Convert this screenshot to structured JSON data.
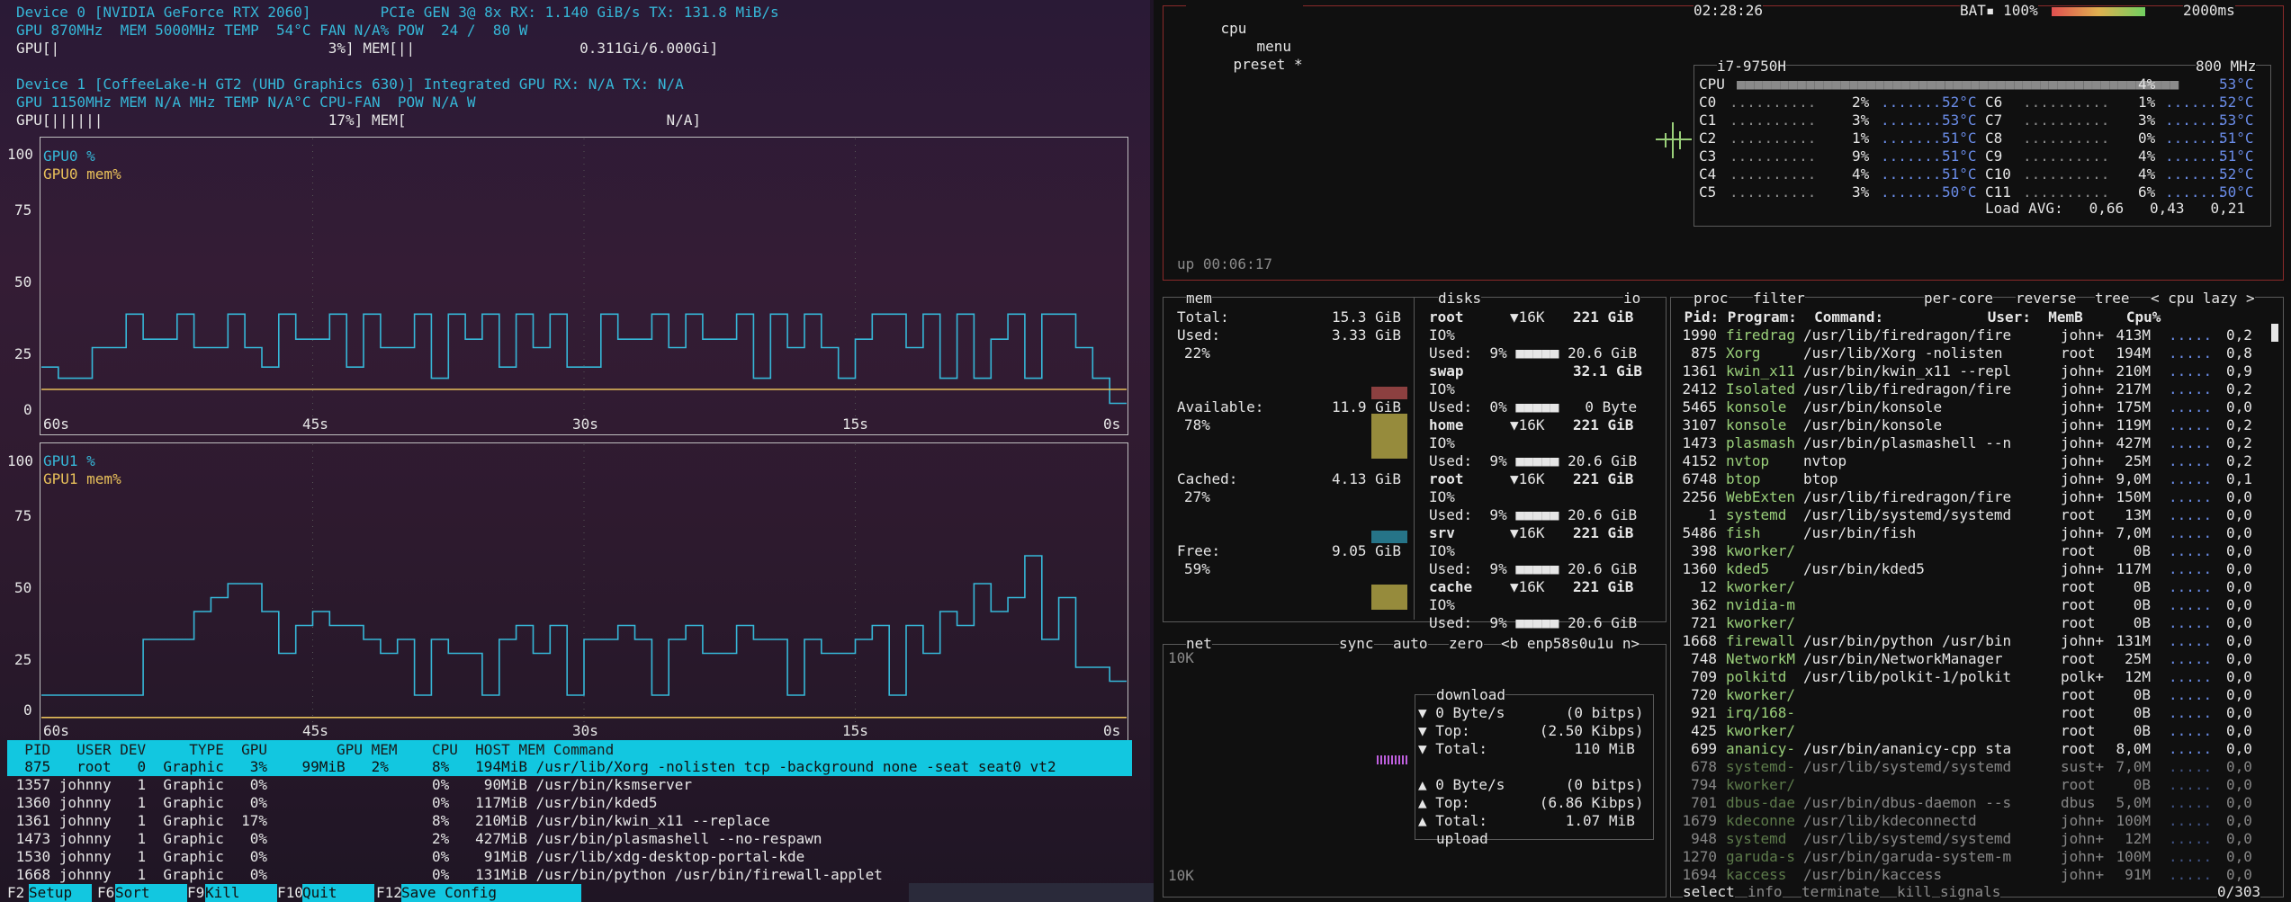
{
  "nvtop": {
    "dev0_line1": "Device 0 [NVIDIA GeForce RTX 2060]        PCIe GEN 3@ 8x RX: 1.140 GiB/s TX: 131.8 MiB/s",
    "dev0_line2": "GPU 870MHz  MEM 5000MHz TEMP  54°C FAN N/A% POW  24 /  80 W",
    "dev0_line3": "GPU[|                               3%] MEM[||                   0.311Gi/6.000Gi]",
    "dev1_line1": "Device 1 [CoffeeLake-H GT2 (UHD Graphics 630)] Integrated GPU RX: N/A TX: N/A",
    "dev1_line2": "GPU 1150MHz MEM N/A MHz TEMP N/A°C CPU-FAN  POW N/A W",
    "dev1_line3": "GPU[||||||                          17%] MEM[                              N/A]",
    "chart1_legend1": "GPU0 %",
    "chart1_legend2": "GPU0 mem%",
    "chart2_legend1": "GPU1 %",
    "chart2_legend2": "GPU1 mem%",
    "y_ticks": [
      "100",
      "75",
      "50",
      "25",
      "0"
    ],
    "x_ticks": [
      "60s",
      "45s",
      "30s",
      "15s",
      "0s"
    ],
    "proc_header": "  PID   USER DEV     TYPE  GPU        GPU MEM    CPU  HOST MEM Command",
    "proc_rows": [
      "  875   root   0  Graphic   3%    99MiB   2%     8%   194MiB /usr/lib/Xorg -nolisten tcp -background none -seat seat0 vt2",
      " 1357 johnny   1  Graphic   0%                   0%    90MiB /usr/bin/ksmserver",
      " 1360 johnny   1  Graphic   0%                   0%   117MiB /usr/bin/kded5",
      " 1361 johnny   1  Graphic  17%                   8%   210MiB /usr/bin/kwin_x11 --replace",
      " 1473 johnny   1  Graphic   0%                   2%   427MiB /usr/bin/plasmashell --no-respawn",
      " 1530 johnny   1  Graphic   0%                   0%    91MiB /usr/lib/xdg-desktop-portal-kde",
      " 1668 johnny   1  Graphic   0%                   0%   131MiB /usr/bin/python /usr/bin/firewall-applet"
    ],
    "fkeys": [
      {
        "k": "F2",
        "l": "Setup"
      },
      {
        "k": "F6",
        "l": "Sort"
      },
      {
        "k": "F9",
        "l": "Kill"
      },
      {
        "k": "F10",
        "l": "Quit"
      },
      {
        "k": "F12",
        "l": "Save Config"
      }
    ]
  },
  "chart_data": [
    {
      "type": "line",
      "series": [
        {
          "name": "GPU0 %",
          "values": [
            18,
            14,
            14,
            25,
            25,
            37,
            28,
            28,
            37,
            25,
            25,
            37,
            25,
            18,
            37,
            28,
            28,
            37,
            18,
            37,
            25,
            25,
            37,
            14,
            37,
            28,
            37,
            18,
            37,
            25,
            37,
            18,
            18,
            37,
            28,
            28,
            37,
            25,
            37,
            28,
            28,
            37,
            14,
            37,
            25,
            37,
            25,
            14,
            28,
            37,
            37,
            25,
            37,
            14,
            37,
            14,
            28,
            37,
            14,
            37,
            37,
            25,
            14,
            5
          ]
        },
        {
          "name": "GPU0 mem%",
          "values": [
            10,
            10,
            10,
            10,
            10,
            10,
            10,
            10,
            10,
            10,
            10,
            10,
            10,
            10,
            10,
            10,
            10,
            10,
            10,
            10,
            10,
            10,
            10,
            10,
            10,
            10,
            10,
            10,
            10,
            10,
            10,
            10,
            10,
            10,
            10,
            10,
            10,
            10,
            10,
            10,
            10,
            10,
            10,
            10,
            10,
            10,
            10,
            10,
            10,
            10,
            10,
            10,
            10,
            10,
            10,
            10,
            10,
            10,
            10,
            10,
            10,
            10,
            10,
            10
          ]
        }
      ],
      "ylim": [
        0,
        100
      ]
    },
    {
      "type": "line",
      "series": [
        {
          "name": "GPU1 %",
          "values": [
            10,
            10,
            10,
            10,
            10,
            10,
            30,
            30,
            30,
            40,
            45,
            50,
            50,
            40,
            25,
            35,
            40,
            35,
            35,
            30,
            25,
            30,
            10,
            30,
            25,
            25,
            10,
            30,
            35,
            25,
            35,
            10,
            30,
            30,
            35,
            30,
            10,
            30,
            35,
            25,
            25,
            35,
            30,
            30,
            10,
            30,
            25,
            25,
            30,
            35,
            10,
            35,
            25,
            40,
            35,
            50,
            40,
            45,
            60,
            30,
            45,
            20,
            20,
            15
          ]
        },
        {
          "name": "GPU1 mem%",
          "values": [
            2,
            2,
            2,
            2,
            2,
            2,
            2,
            2,
            2,
            2,
            2,
            2,
            2,
            2,
            2,
            2,
            2,
            2,
            2,
            2,
            2,
            2,
            2,
            2,
            2,
            2,
            2,
            2,
            2,
            2,
            2,
            2,
            2,
            2,
            2,
            2,
            2,
            2,
            2,
            2,
            2,
            2,
            2,
            2,
            2,
            2,
            2,
            2,
            2,
            2,
            2,
            2,
            2,
            2,
            2,
            2,
            2,
            2,
            2,
            2,
            2,
            2,
            2,
            2
          ]
        }
      ],
      "ylim": [
        0,
        100
      ]
    }
  ],
  "btop": {
    "cpu_tabs": {
      "cpu": "cpu",
      "menu": "menu",
      "preset": "preset *"
    },
    "clock": "02:28:26",
    "bat": "BAT▪ 100%",
    "interval": "2000ms",
    "cpu_model": "i7-9750H",
    "cpu_freq": "800 MHz",
    "cpu_total": {
      "label": "CPU",
      "pct": "4%",
      "temp": "53°C"
    },
    "cores": [
      {
        "l": "C0",
        "p": "2%",
        "t": "52°C",
        "l2": "C6",
        "p2": "1%",
        "t2": "52°C"
      },
      {
        "l": "C1",
        "p": "3%",
        "t": "53°C",
        "l2": "C7",
        "p2": "3%",
        "t2": "53°C"
      },
      {
        "l": "C2",
        "p": "1%",
        "t": "51°C",
        "l2": "C8",
        "p2": "0%",
        "t2": "51°C"
      },
      {
        "l": "C3",
        "p": "9%",
        "t": "51°C",
        "l2": "C9",
        "p2": "4%",
        "t2": "51°C"
      },
      {
        "l": "C4",
        "p": "4%",
        "t": "51°C",
        "l2": "C10",
        "p2": "4%",
        "t2": "52°C"
      },
      {
        "l": "C5",
        "p": "3%",
        "t": "50°C",
        "l2": "C11",
        "p2": "6%",
        "t2": "50°C"
      }
    ],
    "load_avg": "Load AVG:   0,66   0,43   0,21",
    "uptime": "up 00:06:17",
    "mem": {
      "title": "mem",
      "disks_title": "disks",
      "io": "io",
      "total_label": "Total:",
      "total": "15.3 GiB",
      "used_label": "Used:",
      "used": "3.33 GiB",
      "used_pct": "22%",
      "avail_label": "Available:",
      "avail": "11.9 GiB",
      "avail_pct": "78%",
      "cached_label": "Cached:",
      "cached": "4.13 GiB",
      "cached_pct": "27%",
      "free_label": "Free:",
      "free": "9.05 GiB",
      "free_pct": "59%"
    },
    "disks": [
      {
        "name": "root",
        "io": "▼16K",
        "size": "221 GiB",
        "used": "Used:  9% ■■■■■ 20.6 GiB"
      },
      {
        "name": "swap",
        "io": "",
        "size": "32.1 GiB",
        "used": "Used:  0% ■■■■■   0 Byte"
      },
      {
        "name": "home",
        "io": "▼16K",
        "size": "221 GiB",
        "used": "Used:  9% ■■■■■ 20.6 GiB"
      },
      {
        "name": "root",
        "io": "▼16K",
        "size": "221 GiB",
        "used": "Used:  9% ■■■■■ 20.6 GiB"
      },
      {
        "name": "srv",
        "io": "▼16K",
        "size": "221 GiB",
        "used": "Used:  9% ■■■■■ 20.6 GiB"
      },
      {
        "name": "cache",
        "io": "▼16K",
        "size": "221 GiB",
        "used": "Used:  9% ■■■■■ 20.6 GiB"
      }
    ],
    "io_label": "IO%",
    "net": {
      "title": "net",
      "sync": "sync",
      "auto": "auto",
      "zero": "zero",
      "iface": "<b enp58s0u1u n>",
      "scale_top": "10K",
      "scale_bot": "10K",
      "download": "download",
      "dl_rows": [
        "▼ 0 Byte/s       (0 bitps)",
        "▼ Top:        (2.50 Kibps)",
        "▼ Total:          110 MiB"
      ],
      "ul_rows": [
        "▲ 0 Byte/s       (0 bitps)",
        "▲ Top:        (6.86 Kibps)",
        "▲ Total:         1.07 MiB"
      ],
      "upload": "upload"
    },
    "proc": {
      "title": "proc",
      "filter": "filter",
      "per_core": "per-core",
      "reverse": "reverse",
      "tree": "tree",
      "sort": "< cpu lazy >",
      "header": " Pid: Program:  Command:            User:  MemB     Cpu%",
      "rows": [
        {
          "pid": "1990",
          "prog": "firedrag",
          "cmd": "/usr/lib/firedragon/fire",
          "user": "john+",
          "mem": "413M",
          "cpu": "0,2"
        },
        {
          "pid": "875",
          "prog": "Xorg",
          "cmd": "/usr/lib/Xorg -nolisten",
          "user": "root",
          "mem": "194M",
          "cpu": "0,8"
        },
        {
          "pid": "1361",
          "prog": "kwin_x11",
          "cmd": "/usr/bin/kwin_x11 --repl",
          "user": "john+",
          "mem": "210M",
          "cpu": "0,9"
        },
        {
          "pid": "2412",
          "prog": "Isolated",
          "cmd": "/usr/lib/firedragon/fire",
          "user": "john+",
          "mem": "217M",
          "cpu": "0,2"
        },
        {
          "pid": "5465",
          "prog": "konsole",
          "cmd": "/usr/bin/konsole",
          "user": "john+",
          "mem": "175M",
          "cpu": "0,0"
        },
        {
          "pid": "3107",
          "prog": "konsole",
          "cmd": "/usr/bin/konsole",
          "user": "john+",
          "mem": "119M",
          "cpu": "0,2"
        },
        {
          "pid": "1473",
          "prog": "plasmash",
          "cmd": "/usr/bin/plasmashell --n",
          "user": "john+",
          "mem": "427M",
          "cpu": "0,2"
        },
        {
          "pid": "4152",
          "prog": "nvtop",
          "cmd": "nvtop",
          "user": "john+",
          "mem": "25M",
          "cpu": "0,2"
        },
        {
          "pid": "6748",
          "prog": "btop",
          "cmd": "btop",
          "user": "john+",
          "mem": "9,0M",
          "cpu": "0,1"
        },
        {
          "pid": "2256",
          "prog": "WebExten",
          "cmd": "/usr/lib/firedragon/fire",
          "user": "john+",
          "mem": "150M",
          "cpu": "0,0"
        },
        {
          "pid": "1",
          "prog": "systemd",
          "cmd": "/usr/lib/systemd/systemd",
          "user": "root",
          "mem": "13M",
          "cpu": "0,0"
        },
        {
          "pid": "5486",
          "prog": "fish",
          "cmd": "/usr/bin/fish",
          "user": "john+",
          "mem": "7,0M",
          "cpu": "0,0"
        },
        {
          "pid": "398",
          "prog": "kworker/",
          "cmd": "",
          "user": "root",
          "mem": "0B",
          "cpu": "0,0"
        },
        {
          "pid": "1360",
          "prog": "kded5",
          "cmd": "/usr/bin/kded5",
          "user": "john+",
          "mem": "117M",
          "cpu": "0,0"
        },
        {
          "pid": "12",
          "prog": "kworker/",
          "cmd": "",
          "user": "root",
          "mem": "0B",
          "cpu": "0,0"
        },
        {
          "pid": "362",
          "prog": "nvidia-m",
          "cmd": "",
          "user": "root",
          "mem": "0B",
          "cpu": "0,0"
        },
        {
          "pid": "721",
          "prog": "kworker/",
          "cmd": "",
          "user": "root",
          "mem": "0B",
          "cpu": "0,0"
        },
        {
          "pid": "1668",
          "prog": "firewall",
          "cmd": "/usr/bin/python /usr/bin",
          "user": "john+",
          "mem": "131M",
          "cpu": "0,0"
        },
        {
          "pid": "748",
          "prog": "NetworkM",
          "cmd": "/usr/bin/NetworkManager",
          "user": "root",
          "mem": "25M",
          "cpu": "0,0"
        },
        {
          "pid": "709",
          "prog": "polkitd",
          "cmd": "/usr/lib/polkit-1/polkit",
          "user": "polk+",
          "mem": "12M",
          "cpu": "0,0"
        },
        {
          "pid": "720",
          "prog": "kworker/",
          "cmd": "",
          "user": "root",
          "mem": "0B",
          "cpu": "0,0"
        },
        {
          "pid": "921",
          "prog": "irq/168-",
          "cmd": "",
          "user": "root",
          "mem": "0B",
          "cpu": "0,0"
        },
        {
          "pid": "425",
          "prog": "kworker/",
          "cmd": "",
          "user": "root",
          "mem": "0B",
          "cpu": "0,0"
        },
        {
          "pid": "699",
          "prog": "ananicy-",
          "cmd": "/usr/bin/ananicy-cpp sta",
          "user": "root",
          "mem": "8,0M",
          "cpu": "0,0"
        },
        {
          "pid": "678",
          "prog": "systemd-",
          "cmd": "/usr/lib/systemd/systemd",
          "user": "sust+",
          "mem": "7,0M",
          "cpu": "0,0"
        },
        {
          "pid": "794",
          "prog": "kworker/",
          "cmd": "",
          "user": "root",
          "mem": "0B",
          "cpu": "0,0"
        },
        {
          "pid": "701",
          "prog": "dbus-dae",
          "cmd": "/usr/bin/dbus-daemon --s",
          "user": "dbus",
          "mem": "5,0M",
          "cpu": "0,0"
        },
        {
          "pid": "1679",
          "prog": "kdeconne",
          "cmd": "/usr/lib/kdeconnectd",
          "user": "john+",
          "mem": "100M",
          "cpu": "0,0"
        },
        {
          "pid": "948",
          "prog": "systemd",
          "cmd": "/usr/lib/systemd/systemd",
          "user": "john+",
          "mem": "12M",
          "cpu": "0,0"
        },
        {
          "pid": "1270",
          "prog": "garuda-s",
          "cmd": "/usr/bin/garuda-system-m",
          "user": "john+",
          "mem": "100M",
          "cpu": "0,0"
        },
        {
          "pid": "1694",
          "prog": "kaccess",
          "cmd": "/usr/bin/kaccess",
          "user": "john+",
          "mem": "91M",
          "cpu": "0,0"
        }
      ],
      "footer_select": "select",
      "footer_info": "info",
      "footer_terminate": "terminate",
      "footer_kill": "kill",
      "footer_signals": "signals",
      "count": "0/303"
    }
  }
}
